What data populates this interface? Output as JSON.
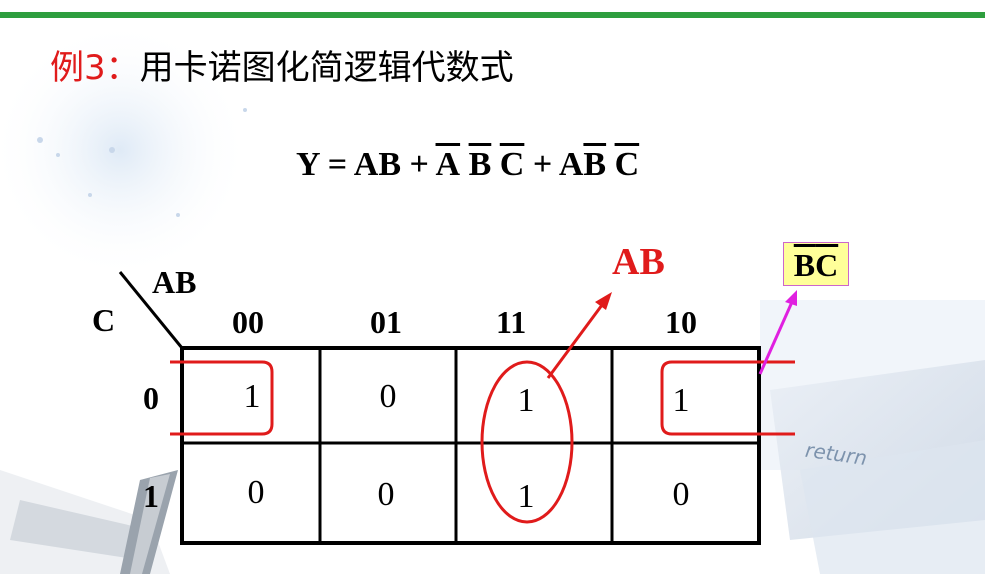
{
  "slide": {
    "title_prefix": "例3：",
    "title_text": "用卡诺图化简逻辑代数式",
    "formula": {
      "lhs": "Y = AB + ",
      "t1a": "A",
      "t1b": "B",
      "t1c": "C",
      "plus": " + A",
      "t2b": "B",
      "t2c": "C"
    }
  },
  "kmap": {
    "row_var": "C",
    "col_var": "AB",
    "col_headers": [
      "00",
      "01",
      "11",
      "10"
    ],
    "row_headers": [
      "0",
      "1"
    ],
    "cells": [
      [
        "1",
        "0",
        "1",
        "1"
      ],
      [
        "0",
        "0",
        "1",
        "0"
      ]
    ]
  },
  "annotations": {
    "group1_label": "AB",
    "group2_label_b": "B",
    "group2_label_c": "C"
  },
  "decor": {
    "return_key_text": "return"
  },
  "colors": {
    "accent_green": "#2e9e3e",
    "group_red": "#e01b1b",
    "arrow_magenta": "#e020e0",
    "note_bg": "#ffff99"
  }
}
